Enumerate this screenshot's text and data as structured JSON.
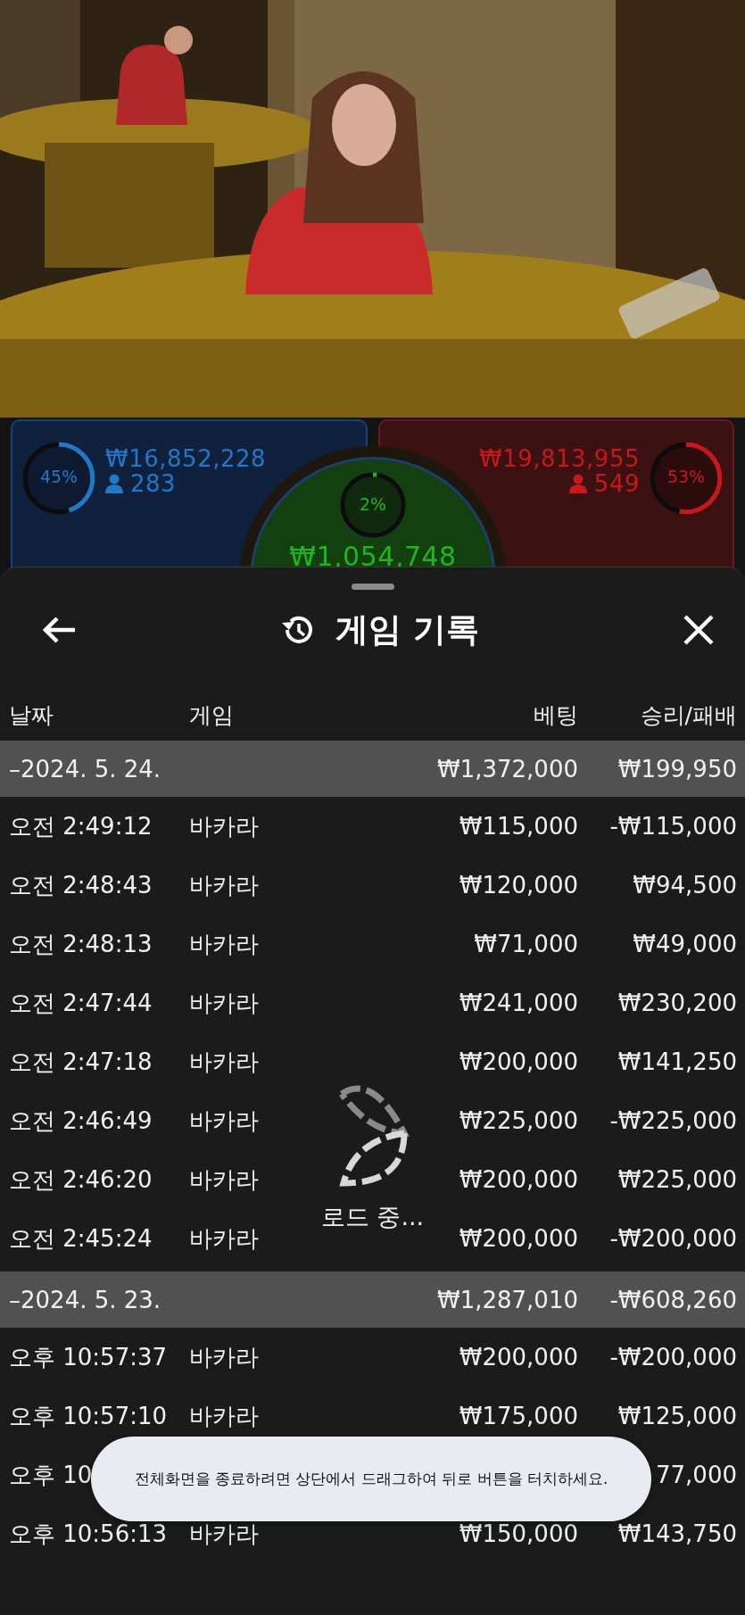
{
  "bet_board": {
    "player": {
      "percent": "45%",
      "level": 0.45,
      "amount": "₩16,852,228",
      "players": "283"
    },
    "banker": {
      "percent": "53%",
      "level": 0.53,
      "amount": "₩19,813,955",
      "players": "549"
    },
    "tie": {
      "percent": "2%",
      "level": 0.02,
      "amount": "₩1,054,748"
    }
  },
  "sheet": {
    "title": "게임 기록",
    "columns": [
      "날짜",
      "게임",
      "베팅",
      "승리/패배"
    ],
    "groups": [
      {
        "date": "–2024. 5. 24.",
        "bet": "₩1,372,000",
        "result": "₩199,950",
        "rows": [
          {
            "time": "오전 2:49:12",
            "game": "바카라",
            "bet": "₩115,000",
            "result": "-₩115,000"
          },
          {
            "time": "오전 2:48:43",
            "game": "바카라",
            "bet": "₩120,000",
            "result": "₩94,500"
          },
          {
            "time": "오전 2:48:13",
            "game": "바카라",
            "bet": "₩71,000",
            "result": "₩49,000"
          },
          {
            "time": "오전 2:47:44",
            "game": "바카라",
            "bet": "₩241,000",
            "result": "₩230,200"
          },
          {
            "time": "오전 2:47:18",
            "game": "바카라",
            "bet": "₩200,000",
            "result": "₩141,250"
          },
          {
            "time": "오전 2:46:49",
            "game": "바카라",
            "bet": "₩225,000",
            "result": "-₩225,000"
          },
          {
            "time": "오전 2:46:20",
            "game": "바카라",
            "bet": "₩200,000",
            "result": "₩225,000"
          },
          {
            "time": "오전 2:45:24",
            "game": "바카라",
            "bet": "₩200,000",
            "result": "-₩200,000"
          }
        ]
      },
      {
        "date": "–2024. 5. 23.",
        "bet": "₩1,287,010",
        "result": "-₩608,260",
        "rows": [
          {
            "time": "오후 10:57:37",
            "game": "바카라",
            "bet": "₩200,000",
            "result": "-₩200,000"
          },
          {
            "time": "오후 10:57:10",
            "game": "바카라",
            "bet": "₩175,000",
            "result": "₩125,000"
          },
          {
            "time": "오후 10",
            "result": "77,000"
          },
          {
            "time": "오후 10:56:13",
            "game": "바카라",
            "bet": "₩150,000",
            "result": "₩143,750"
          }
        ]
      }
    ],
    "loading": "로드 중..."
  },
  "toast": "전체화면을 종료하려면 상단에서 드래그하여 뒤로 버튼을 터치하세요."
}
